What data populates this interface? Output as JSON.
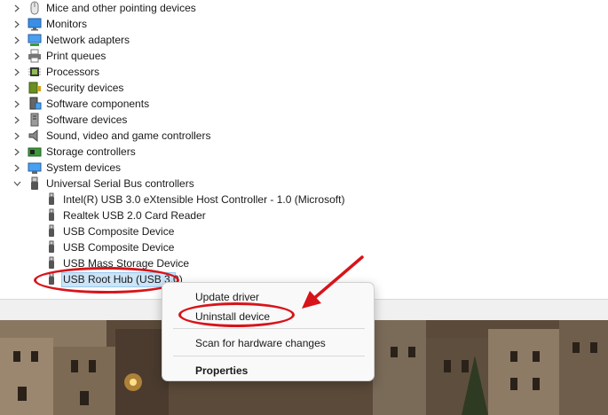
{
  "tree": {
    "categories": [
      {
        "label": "Mice and other pointing devices",
        "icon": "mouse-icon"
      },
      {
        "label": "Monitors",
        "icon": "monitor-icon"
      },
      {
        "label": "Network adapters",
        "icon": "network-adapter-icon"
      },
      {
        "label": "Print queues",
        "icon": "printer-icon"
      },
      {
        "label": "Processors",
        "icon": "processor-icon"
      },
      {
        "label": "Security devices",
        "icon": "security-device-icon"
      },
      {
        "label": "Software components",
        "icon": "software-component-icon"
      },
      {
        "label": "Software devices",
        "icon": "software-device-icon"
      },
      {
        "label": "Sound, video and game controllers",
        "icon": "speaker-icon"
      },
      {
        "label": "Storage controllers",
        "icon": "storage-controller-icon"
      },
      {
        "label": "System devices",
        "icon": "system-device-icon"
      },
      {
        "label": "Universal Serial Bus controllers",
        "icon": "usb-controller-icon",
        "expanded": true
      }
    ],
    "usb_children": [
      {
        "label": "Intel(R) USB 3.0 eXtensible Host Controller - 1.0 (Microsoft)",
        "icon": "usb-plug-icon"
      },
      {
        "label": "Realtek USB 2.0 Card Reader",
        "icon": "usb-plug-icon"
      },
      {
        "label": "USB Composite Device",
        "icon": "usb-plug-icon"
      },
      {
        "label": "USB Composite Device",
        "icon": "usb-plug-icon"
      },
      {
        "label": "USB Mass Storage Device",
        "icon": "usb-plug-icon"
      },
      {
        "label": "USB Root Hub (USB 3.0)",
        "icon": "usb-plug-icon",
        "selected": true
      }
    ]
  },
  "context_menu": {
    "items": [
      "Update driver",
      "Uninstall device",
      "Scan for hardware changes",
      "Properties"
    ]
  },
  "colors": {
    "annotation_red": "#d7141a",
    "selection_bg": "#cce4f7",
    "selection_border": "#99c9ef"
  }
}
